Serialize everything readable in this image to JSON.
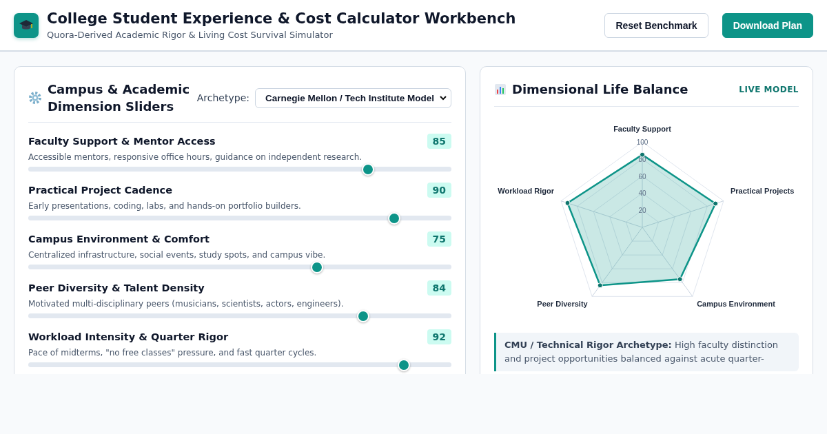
{
  "header": {
    "title": "College Student Experience & Cost Calculator Workbench",
    "subtitle": "Quora-Derived Academic Rigor & Living Cost Survival Simulator",
    "buttons": [
      {
        "label": "Reset Benchmark",
        "kind": "secondary"
      },
      {
        "label": "Download Plan",
        "kind": "primary"
      }
    ]
  },
  "sliders_panel": {
    "title": "Campus & Academic Dimension Sliders",
    "archetype_label": "Archetype:",
    "archetype_value": "Carnegie Mellon / Tech Institute Model",
    "sliders": [
      {
        "name": "Faculty Support & Mentor Access",
        "value": "85",
        "description": "Accessible mentors, responsive office hours, guidance on independent research.",
        "level": 0.8125
      },
      {
        "name": "Practical Project Cadence",
        "value": "90",
        "description": "Early presentations, coding, labs, and hands-on portfolio builders.",
        "level": 0.875
      },
      {
        "name": "Campus Environment & Comfort",
        "value": "75",
        "description": "Centralized infrastructure, social events, study spots, and campus vibe.",
        "level": 0.6875
      },
      {
        "name": "Peer Diversity & Talent Density",
        "value": "84",
        "description": "Motivated multi-disciplinary peers (musicians, scientists, actors, engineers).",
        "level": 0.8
      },
      {
        "name": "Workload Intensity & Quarter Rigor",
        "value": "92",
        "description": "Pace of midterms, \"no free classes\" pressure, and fast quarter cycles.",
        "level": 0.9
      }
    ]
  },
  "balance_panel": {
    "title": "Dimensional Life Balance",
    "badge": "LIVE MODEL",
    "radar": {
      "kind": "radar",
      "axis_labels": [
        "Faculty Support",
        "Workload Rigor",
        "Practical Projects",
        "Peer Diversity",
        "Campus Environment"
      ],
      "tick_labels": [
        "100",
        "80",
        "60",
        "40",
        "20"
      ]
    },
    "note": "**CMU / Technical Rigor Archetype:** High faculty distinction and project opportunities balanced against acute quarter-"
  }
}
